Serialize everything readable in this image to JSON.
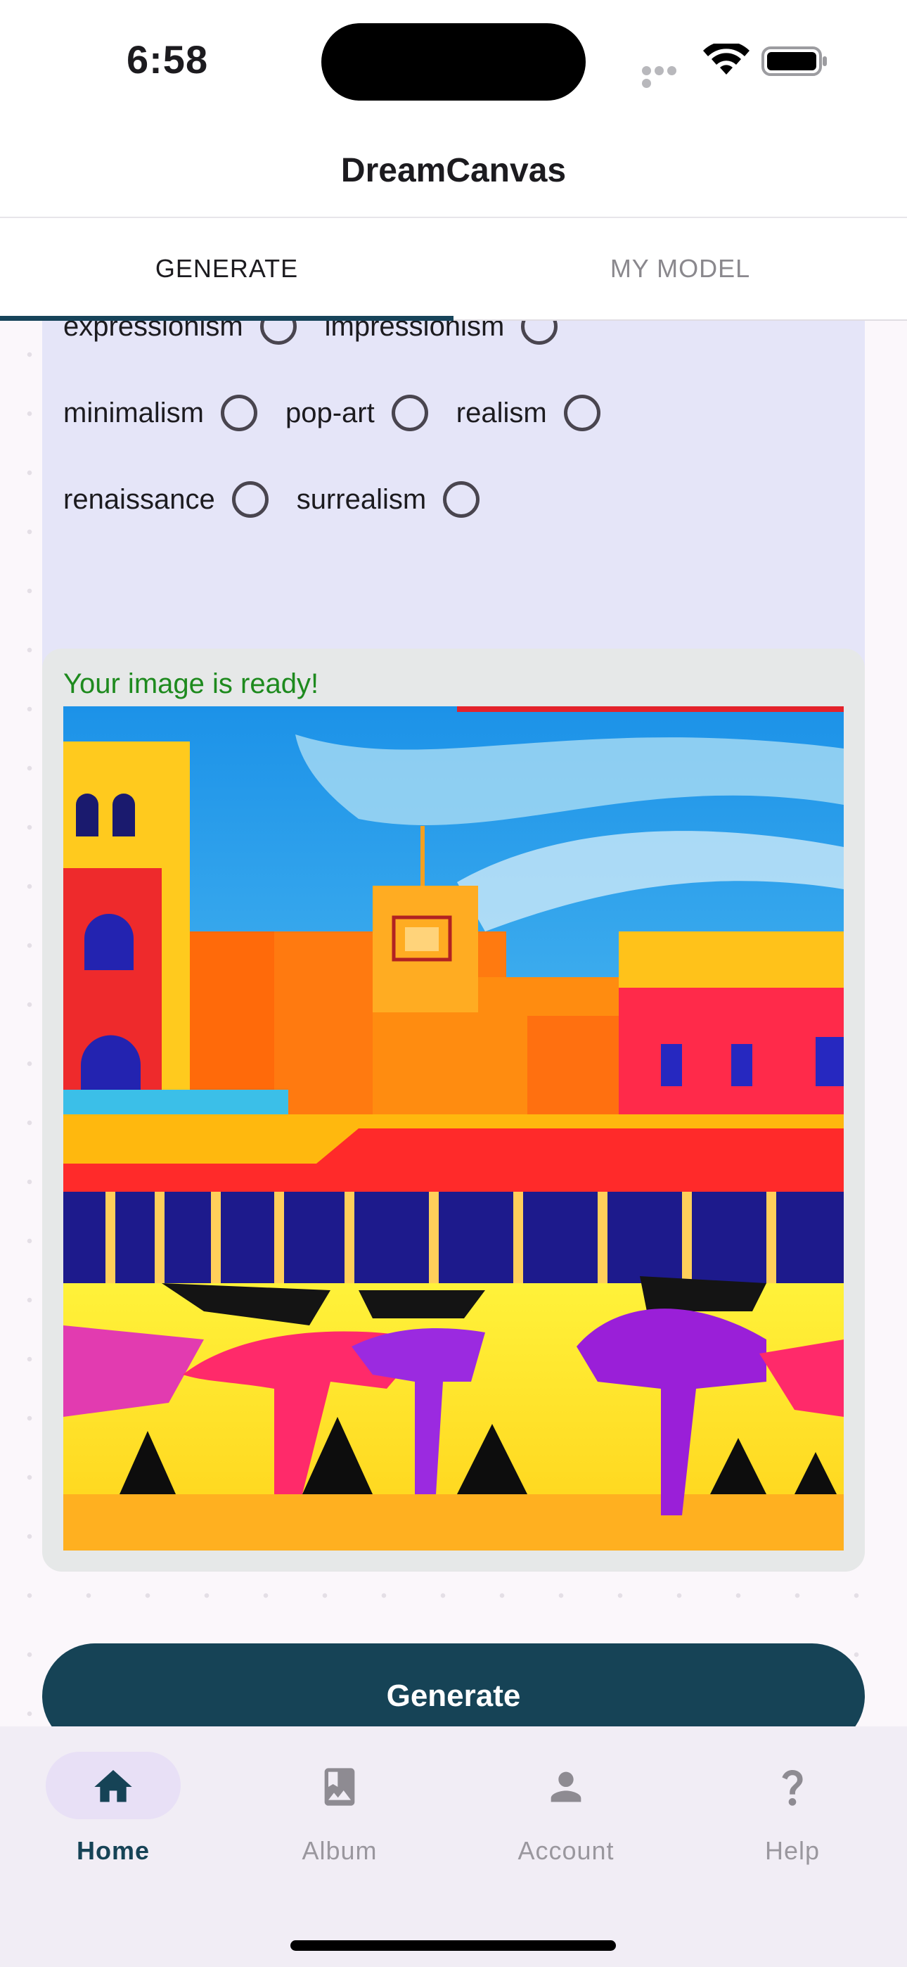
{
  "status_bar": {
    "time": "6:58"
  },
  "app": {
    "title": "DreamCanvas"
  },
  "tabs": [
    {
      "label": "GENERATE",
      "selected": true
    },
    {
      "label": "MY MODEL",
      "selected": false
    }
  ],
  "styles": {
    "options": [
      {
        "label": "expressionism",
        "selected": false
      },
      {
        "label": "impressionism",
        "selected": false
      },
      {
        "label": "minimalism",
        "selected": false
      },
      {
        "label": "pop-art",
        "selected": false
      },
      {
        "label": "realism",
        "selected": false
      },
      {
        "label": "renaissance",
        "selected": false
      },
      {
        "label": "surrealism",
        "selected": false
      }
    ]
  },
  "result": {
    "status": "Your image is ready!",
    "status_color": "#1e8a1e"
  },
  "actions": {
    "generate_label": "Generate"
  },
  "bottom_nav": [
    {
      "label": "Home",
      "icon": "home-icon",
      "active": true
    },
    {
      "label": "Album",
      "icon": "album-icon",
      "active": false
    },
    {
      "label": "Account",
      "icon": "account-icon",
      "active": false
    },
    {
      "label": "Help",
      "icon": "help-icon",
      "active": false
    }
  ],
  "colors": {
    "primary": "#164356",
    "style_card": "#e5e5f8",
    "result_card": "#e6e8e8",
    "nav_background": "#f1edf5"
  }
}
